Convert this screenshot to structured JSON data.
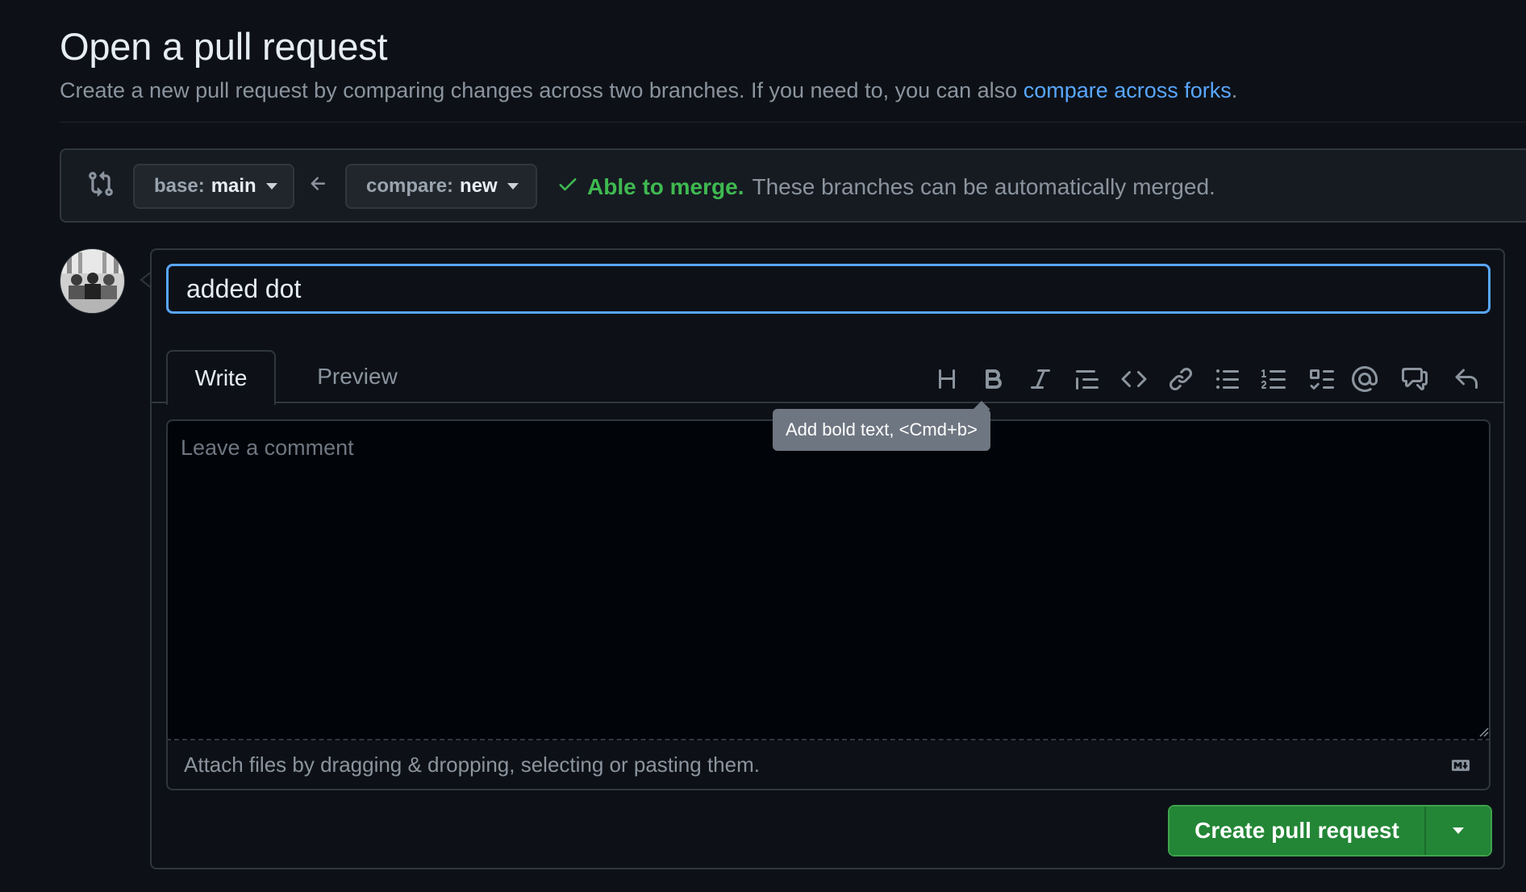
{
  "header": {
    "title": "Open a pull request",
    "subtitle_text": "Create a new pull request by comparing changes across two branches. If you need to, you can also ",
    "subtitle_link": "compare across forks",
    "subtitle_end": "."
  },
  "compare_bar": {
    "base_label": "base:",
    "base_value": "main",
    "compare_label": "compare:",
    "compare_value": "new",
    "merge_ok": "Able to merge.",
    "merge_desc": "These branches can be automatically merged."
  },
  "editor": {
    "title_value": "added dot",
    "tabs": [
      {
        "label": "Write"
      },
      {
        "label": "Preview"
      }
    ],
    "toolbar_icons": [
      "heading-icon",
      "bold-icon",
      "italic-icon",
      "quote-icon",
      "code-icon",
      "link-icon",
      "unordered-list-icon",
      "ordered-list-icon",
      "task-list-icon",
      "mention-icon",
      "cross-reference-icon",
      "reply-icon"
    ],
    "tooltip": "Add bold text, <Cmd+b>",
    "comment_placeholder": "Leave a comment",
    "attach_text": "Attach files by dragging & dropping, selecting or pasting them.",
    "create_button": "Create pull request"
  },
  "colors": {
    "background": "#0d1117",
    "accent_blue": "#58a6ff",
    "success_green": "#3fb950",
    "button_green": "#238636"
  }
}
